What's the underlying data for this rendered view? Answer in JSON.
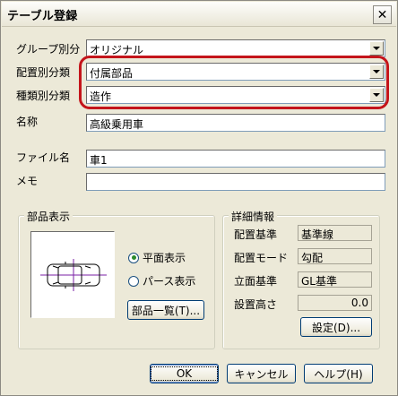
{
  "window": {
    "title": "テーブル登録",
    "close_label": "✕"
  },
  "fields": {
    "group": {
      "label": "グループ別分",
      "value": "オリジナル"
    },
    "placement": {
      "label": "配置別分類",
      "value": "付属部品"
    },
    "type": {
      "label": "種類別分類",
      "value": "造作"
    },
    "name": {
      "label": "名称",
      "value": "高級乗用車"
    },
    "filename": {
      "label": "ファイル名",
      "value": "車1"
    },
    "memo": {
      "label": "メモ",
      "value": ""
    }
  },
  "part_display": {
    "title": "部品表示",
    "radios": [
      {
        "label": "平面表示",
        "checked": true
      },
      {
        "label": "パース表示",
        "checked": false
      }
    ],
    "list_button": "部品一覧(T)..."
  },
  "details": {
    "title": "詳細情報",
    "rows": [
      {
        "label": "配置基準",
        "value": "基準線"
      },
      {
        "label": "配置モード",
        "value": "勾配"
      },
      {
        "label": "立面基準",
        "value": "GL基準"
      },
      {
        "label": "設置高さ",
        "value": "0.0"
      }
    ],
    "settings_button": "設定(D)..."
  },
  "buttons": {
    "ok": "OK",
    "cancel": "キャンセル",
    "help": "ヘルプ(H)"
  },
  "colors": {
    "highlight": "#c4151b",
    "dialog_bg": "#ece9d8"
  },
  "icons": {
    "close": "close-icon",
    "car": "car-top-view-icon",
    "dropdown": "chevron-down-icon"
  }
}
